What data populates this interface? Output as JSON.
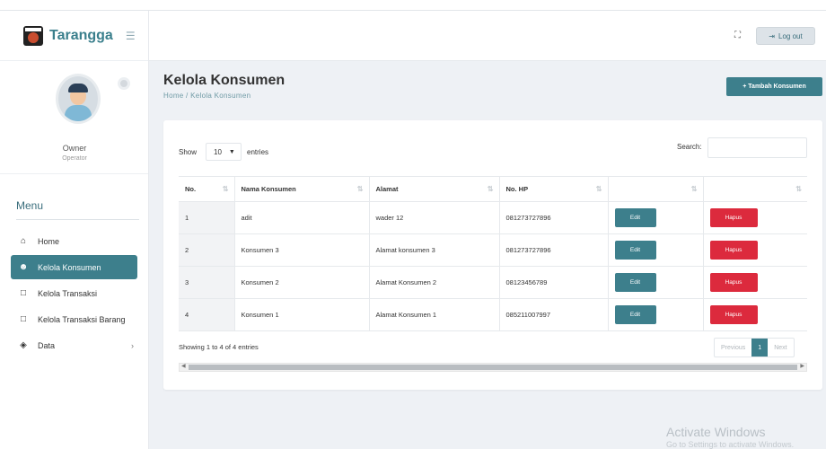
{
  "brand": {
    "name": "Tarangga"
  },
  "profile": {
    "name": "Owner",
    "role": "Operator"
  },
  "menu": {
    "title": "Menu",
    "items": [
      {
        "label": "Home",
        "icon": "home-icon"
      },
      {
        "label": "Kelola Konsumen",
        "icon": "user-icon",
        "active": true
      },
      {
        "label": "Kelola Transaksi",
        "icon": "document-icon"
      },
      {
        "label": "Kelola Transaksi Barang",
        "icon": "document-icon"
      },
      {
        "label": "Data",
        "icon": "box-icon"
      }
    ]
  },
  "header": {
    "logout_label": "Log out",
    "fullscreen_icon": "fullscreen-icon"
  },
  "page": {
    "title": "Kelola Konsumen",
    "breadcrumb": "Home / Kelola Konsumen",
    "add_button": "+ Tambah Konsumen"
  },
  "table": {
    "show_label": "Show",
    "entries_value": "10",
    "entries_label": "entries",
    "search_label": "Search:",
    "headers": [
      "No.",
      "Nama Konsumen",
      "Alamat",
      "No. HP",
      "",
      ""
    ],
    "rows": [
      {
        "no": "1",
        "nama": "adit",
        "alamat": "wader 12",
        "hp": "081273727896"
      },
      {
        "no": "2",
        "nama": "Konsumen 3",
        "alamat": "Alamat konsumen 3",
        "hp": "081273727896"
      },
      {
        "no": "3",
        "nama": "Konsumen 2",
        "alamat": "Alamat Konsumen 2",
        "hp": "08123456789"
      },
      {
        "no": "4",
        "nama": "Konsumen 1",
        "alamat": "Alamat Konsumen 1",
        "hp": "085211007997"
      }
    ],
    "edit_label": "Edit",
    "delete_label": "Hapus",
    "info": "Showing 1 to 4 of 4 entries",
    "pagination": {
      "previous": "Previous",
      "current": "1",
      "next": "Next"
    }
  },
  "watermark": {
    "line1": "Activate Windows",
    "line2": "Go to Settings to activate Windows."
  },
  "colors": {
    "accent": "#3d7f8c",
    "danger": "#dc2a3d"
  }
}
